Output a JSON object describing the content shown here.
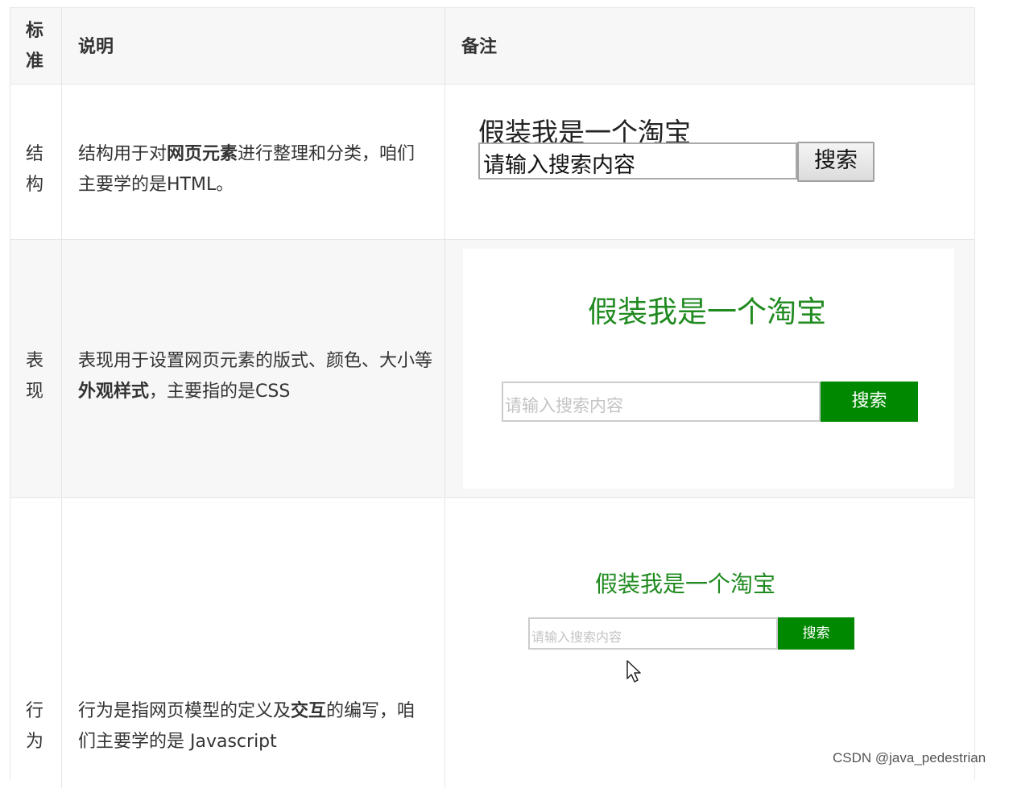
{
  "header": {
    "col1": [
      "标",
      "准"
    ],
    "col2": "说明",
    "col3": "备注"
  },
  "rows": [
    {
      "standard": [
        "结",
        "构"
      ],
      "desc_pre": "结构用于对",
      "desc_bold": "网页元素",
      "desc_post": "进行整理和分类，咱们主要学的是HTML。",
      "demo": {
        "title": "假装我是一个淘宝",
        "input_value": "请输入搜索内容",
        "button": "搜索"
      }
    },
    {
      "standard": [
        "表",
        "现"
      ],
      "desc_pre": "表现用于设置网页元素的版式、颜色、大小等",
      "desc_bold": "外观样式",
      "desc_post": "，主要指的是CSS",
      "demo": {
        "title": "假装我是一个淘宝",
        "input_placeholder": "请输入搜索内容",
        "button": "搜索",
        "accent": "#008800"
      }
    },
    {
      "standard": [
        "行",
        "为"
      ],
      "desc_pre": "行为是指网页模型的定义及",
      "desc_bold": "交互",
      "desc_post": "的编写，咱们主要学的是 Javascript",
      "demo": {
        "title": "假装我是一个淘宝",
        "input_placeholder": "请输入搜索内容",
        "button": "搜索",
        "accent": "#008800"
      }
    }
  ],
  "watermark": "CSDN @java_pedestrian"
}
